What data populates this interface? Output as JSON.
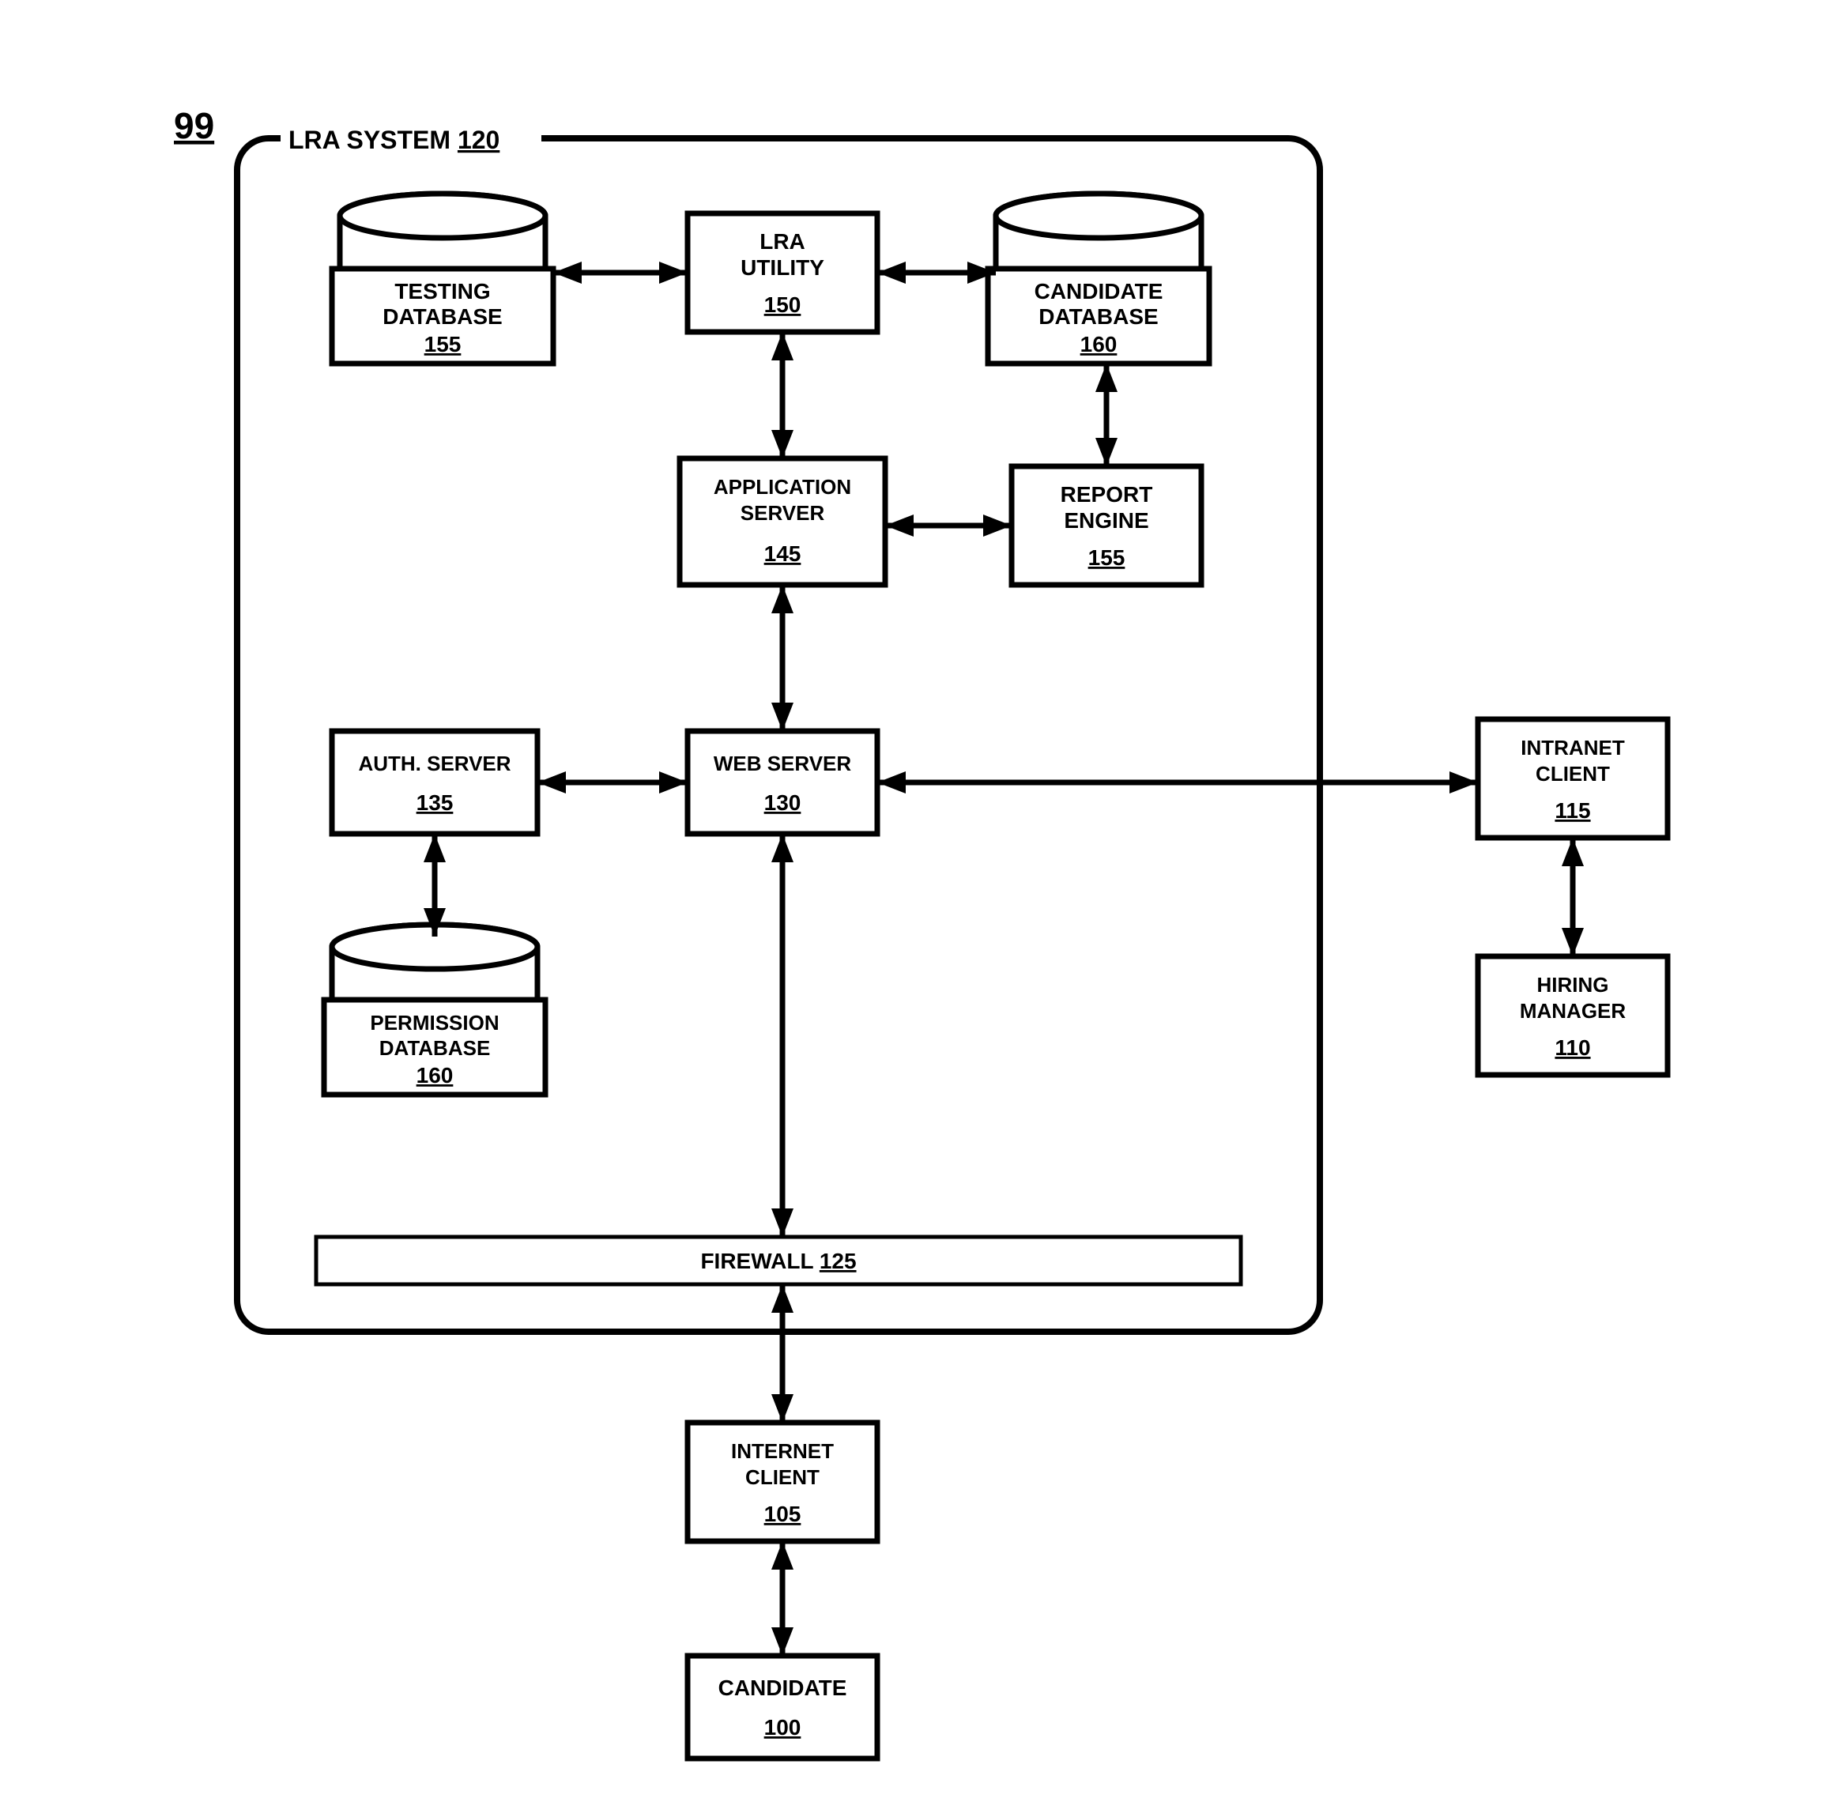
{
  "figure_ref": "99",
  "system_frame": {
    "label": "LRA SYSTEM",
    "ref": "120"
  },
  "nodes": {
    "testing_db": {
      "label": "TESTING DATABASE",
      "ref": "155",
      "type": "database"
    },
    "lra_utility": {
      "label": "LRA UTILITY",
      "ref": "150",
      "type": "box"
    },
    "candidate_db": {
      "label": "CANDIDATE DATABASE",
      "ref": "160",
      "type": "database"
    },
    "app_server": {
      "label": "APPLICATION SERVER",
      "ref": "145",
      "type": "box"
    },
    "report_engine": {
      "label": "REPORT ENGINE",
      "ref": "155",
      "type": "box"
    },
    "auth_server": {
      "label": "AUTH. SERVER",
      "ref": "135",
      "type": "box"
    },
    "web_server": {
      "label": "WEB SERVER",
      "ref": "130",
      "type": "box"
    },
    "perm_db": {
      "label": "PERMISSION DATABASE",
      "ref": "160",
      "type": "database"
    },
    "firewall": {
      "label": "FIREWALL",
      "ref": "125",
      "type": "bar"
    },
    "intranet_client": {
      "label": "INTRANET CLIENT",
      "ref": "115",
      "type": "box"
    },
    "hiring_manager": {
      "label": "HIRING MANAGER",
      "ref": "110",
      "type": "box"
    },
    "internet_client": {
      "label": "INTERNET CLIENT",
      "ref": "105",
      "type": "box"
    },
    "candidate": {
      "label": "CANDIDATE",
      "ref": "100",
      "type": "box"
    }
  }
}
